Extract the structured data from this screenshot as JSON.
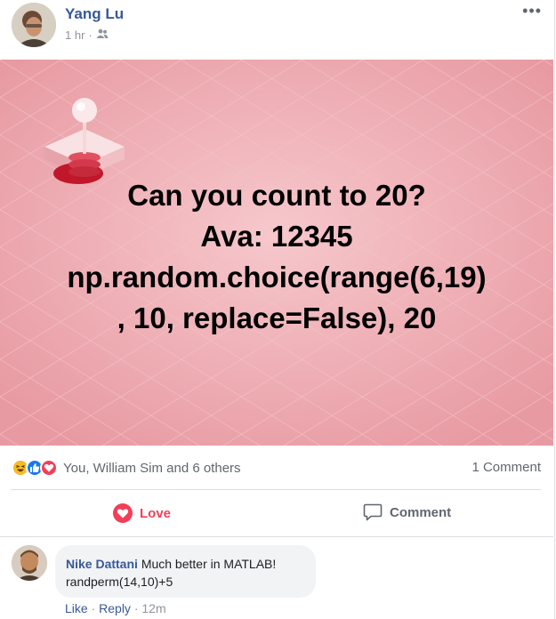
{
  "post": {
    "author": "Yang Lu",
    "time": "1 hr",
    "time_separator": " ·",
    "audience_icon": "friends-icon",
    "more_icon": "more-options-icon",
    "more_label": "•••"
  },
  "image": {
    "caption_lines": [
      "Can you count to 20?",
      "Ava: 12345",
      "np.random.choice(range(6,19)",
      ", 10, replace=False), 20"
    ],
    "colors": {
      "background": "#eeaab0",
      "text": "#000000"
    }
  },
  "reactions": {
    "icons": [
      "haha-icon",
      "like-icon",
      "love-icon"
    ],
    "names": "You, William Sim and 6 others",
    "comment_count": "1 Comment"
  },
  "actions": {
    "love_label": "Love",
    "comment_label": "Comment"
  },
  "comment": {
    "author": "Nike Dattani",
    "text_line1": "Much better in MATLAB!",
    "text_line2": "randperm(14,10)+5",
    "like_label": "Like",
    "separator": " · ",
    "reply_label": "Reply",
    "time": "12m"
  },
  "colors": {
    "link_blue": "#385898",
    "love_red": "#f33e58",
    "like_blue": "#1877f2",
    "haha_yellow": "#f7b928",
    "secondary_text": "#606770"
  }
}
